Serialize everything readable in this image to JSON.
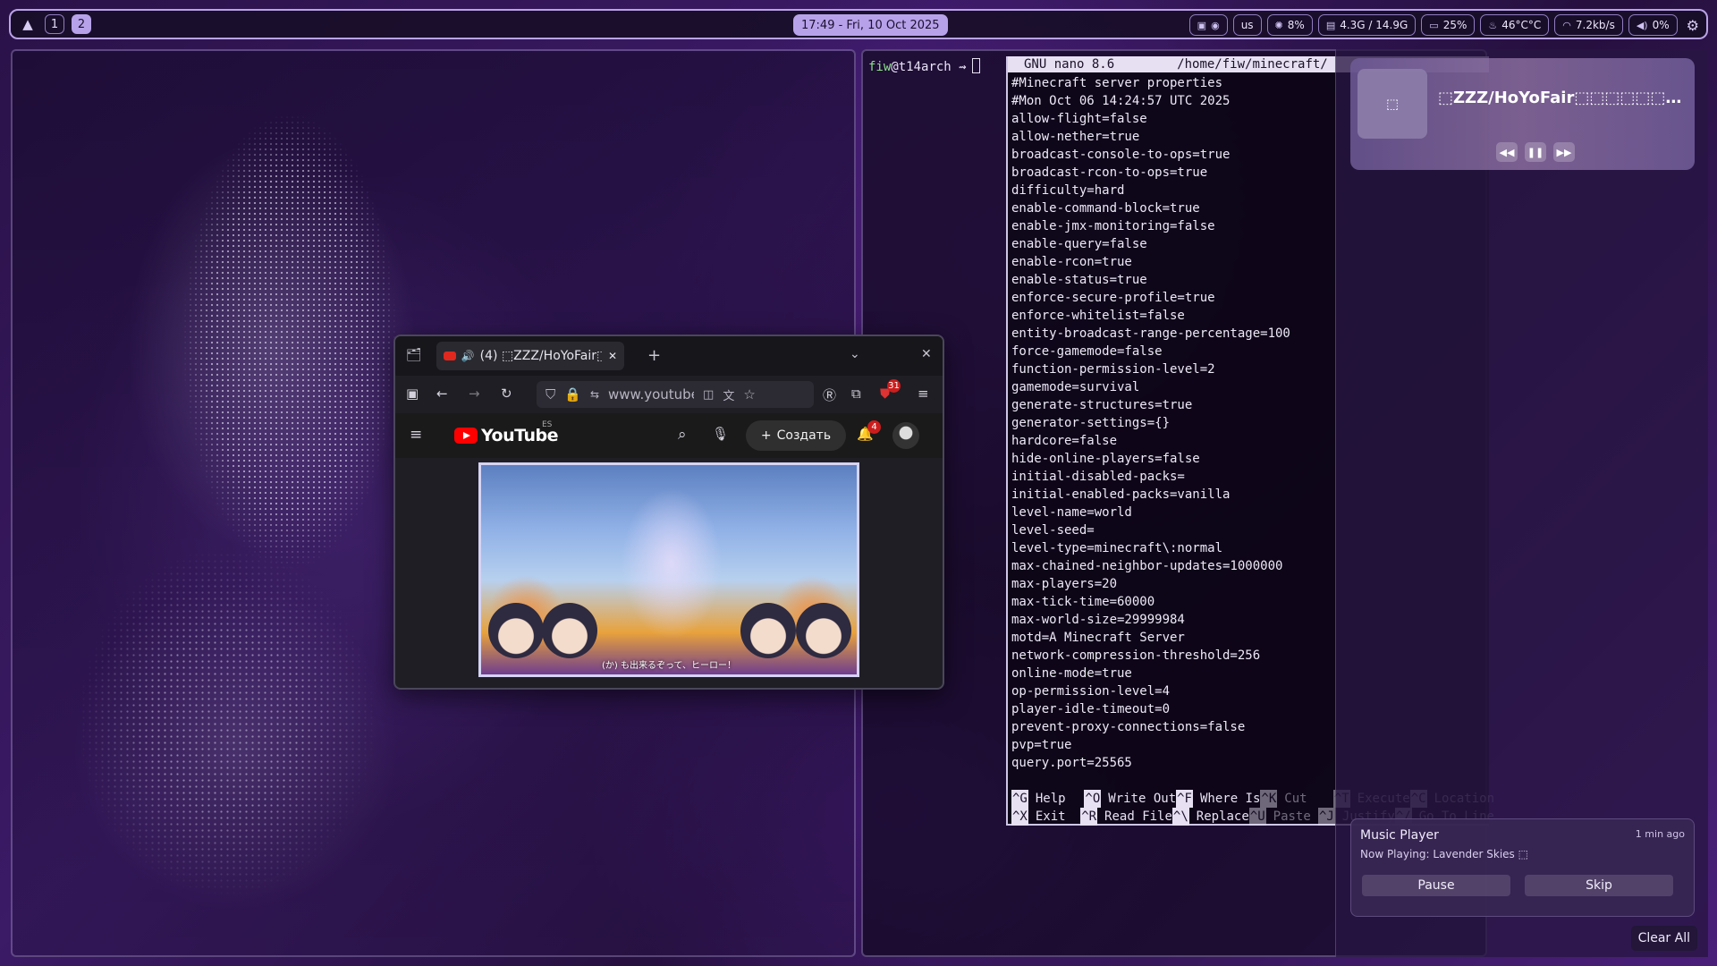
{
  "topbar": {
    "workspaces": [
      "1",
      "2"
    ],
    "active_workspace": "2",
    "clock": "17:49 - Fri, 10 Oct 2025",
    "tray": [
      {
        "icon": "discord-icon"
      },
      {
        "icon": "steam-icon"
      }
    ],
    "keyboard_layout": "us",
    "cpu": "8%",
    "memory": "4.3G / 14.9G",
    "battery": "25%",
    "temperature": "46°C°C",
    "network": "7.2kb/s",
    "volume": "0%"
  },
  "terminal": {
    "user": "fiw",
    "host_prompt": "@t14arch ⇝",
    "nano": {
      "title": "GNU nano 8.6",
      "path": "/home/fiw/minecraft/",
      "lines": [
        "#Minecraft server properties",
        "#Mon Oct 06 14:24:57 UTC 2025",
        "allow-flight=false",
        "allow-nether=true",
        "broadcast-console-to-ops=true",
        "broadcast-rcon-to-ops=true",
        "difficulty=hard",
        "enable-command-block=true",
        "enable-jmx-monitoring=false",
        "enable-query=false",
        "enable-rcon=true",
        "enable-status=true",
        "enforce-secure-profile=true",
        "enforce-whitelist=false",
        "entity-broadcast-range-percentage=100",
        "force-gamemode=false",
        "function-permission-level=2",
        "gamemode=survival",
        "generate-structures=true",
        "generator-settings={}",
        "hardcore=false",
        "hide-online-players=false",
        "initial-disabled-packs=",
        "initial-enabled-packs=vanilla",
        "level-name=world",
        "level-seed=",
        "level-type=minecraft\\:normal",
        "max-chained-neighbor-updates=1000000",
        "max-players=20",
        "max-tick-time=60000",
        "max-world-size=29999984",
        "motd=A Minecraft Server",
        "network-compression-threshold=256",
        "online-mode=true",
        "op-permission-level=4",
        "player-idle-timeout=0",
        "prevent-proxy-connections=false",
        "pvp=true",
        "query.port=25565"
      ],
      "shortcuts_row1": [
        {
          "key": "^G",
          "label": "Help"
        },
        {
          "key": "^O",
          "label": "Write Out"
        },
        {
          "key": "^F",
          "label": "Where Is"
        },
        {
          "key": "^K",
          "label": "Cut"
        },
        {
          "key": "^T",
          "label": "Execute"
        },
        {
          "key": "^C",
          "label": "Location"
        }
      ],
      "shortcuts_row2": [
        {
          "key": "^X",
          "label": "Exit"
        },
        {
          "key": "^R",
          "label": "Read File"
        },
        {
          "key": "^\\",
          "label": "Replace"
        },
        {
          "key": "^U",
          "label": "Paste"
        },
        {
          "key": "^J",
          "label": "Justify"
        },
        {
          "key": "^/",
          "label": "Go To Line"
        }
      ]
    }
  },
  "media_widget": {
    "title": "⬚ZZZ/HoYoFair⬚⬚⬚⬚⬚⬚⬚⬚…",
    "art_glyph": "⬚"
  },
  "notification": {
    "app": "Music Player",
    "time": "1 min ago",
    "body": "Now Playing: Lavender Skies ⬚",
    "actions": [
      "Pause",
      "Skip"
    ]
  },
  "clear_all": "Clear All",
  "browser": {
    "tab_title": "(4) ⬚ZZZ/HoYoFair⬚",
    "url": "www.youtube.com",
    "extension_badge": "31",
    "youtube": {
      "logo_text": "YouTube",
      "country_code": "ES",
      "create_label": "Создать",
      "notifications_count": "4",
      "video_subtitle": "(か) も出来るぞって、ヒーロー！"
    }
  }
}
